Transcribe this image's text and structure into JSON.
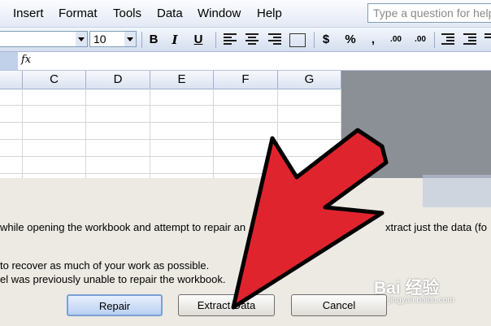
{
  "menubar": {
    "items": [
      "Insert",
      "Format",
      "Tools",
      "Data",
      "Window",
      "Help"
    ],
    "ask_placeholder": "Type a question for help"
  },
  "toolbar": {
    "font_size": "10",
    "bold": "B",
    "italic": "I",
    "underline": "U",
    "currency": "$",
    "percent": "%",
    "comma": ",",
    "increase_decimal": ".00",
    "decrease_decimal": ".00"
  },
  "formula_bar": {
    "fx_label": "fx"
  },
  "grid": {
    "columns": [
      "C",
      "D",
      "E",
      "F",
      "G"
    ]
  },
  "dialog": {
    "line1_left": "while opening the workbook and attempt to repair an",
    "line1_right": "xtract just the data (fo",
    "line2": "to recover as much of your work as possible.",
    "line3": "el was previously unable to repair the workbook.",
    "buttons": {
      "repair": "Repair",
      "extract": "Extract Data",
      "cancel": "Cancel"
    }
  },
  "watermark": {
    "main": "Bai 经验",
    "sub": "jingyan.baidu.com"
  },
  "colors": {
    "arrow": "#e0242e",
    "arrow_outline": "#000000",
    "dialog_bg": "#eceae3"
  }
}
